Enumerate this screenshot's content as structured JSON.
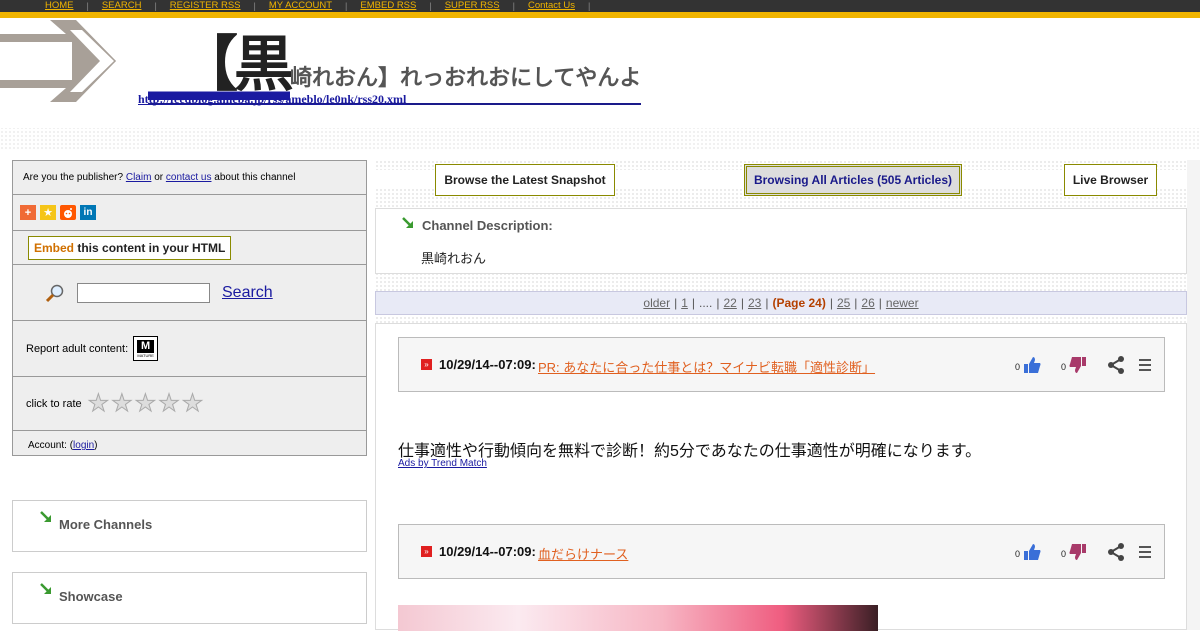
{
  "nav": {
    "items": [
      "HOME",
      "SEARCH",
      "REGISTER RSS",
      "MY ACCOUNT",
      "EMBED RSS",
      "SUPER RSS",
      "Contact Us"
    ],
    "separator": "|"
  },
  "header": {
    "title_big": "【黒",
    "title_rest": "崎れおん】れっおれおにしてやんよ",
    "feed_url": "http://feedblog.ameba.jp/rss/ameblo/le0nk/rss20.xml"
  },
  "sidebar": {
    "publisher_prefix": "Are you the publisher?",
    "claim": "Claim",
    "or": "or",
    "contact": "contact us",
    "publisher_suffix": "about this channel",
    "embed_word": "Embed",
    "embed_rest": " this content in your HTML",
    "search_label": "Search",
    "report_label": "Report adult content:",
    "mature_letter": "M",
    "mature_text": "MATURE",
    "rate_label": "click to rate",
    "account_prefix": "Account: (",
    "login": "login",
    "account_suffix": ")",
    "more_channels": "More Channels",
    "showcase": "Showcase"
  },
  "tabs": {
    "latest": "Browse the Latest Snapshot",
    "all": "Browsing All Articles (505 Articles)",
    "live": "Live Browser"
  },
  "channel": {
    "desc_label": "Channel Description:",
    "desc_text": "黒崎れおん"
  },
  "pager": {
    "older": "older",
    "p1": "1",
    "dots": "....",
    "p22": "22",
    "p23": "23",
    "current": "(Page 24)",
    "p25": "25",
    "p26": "26",
    "newer": "newer",
    "sep": "|"
  },
  "posts": [
    {
      "date": "10/29/14--07:09:",
      "title": "PR: あなたに合った仕事とは？マイナビ転職「適性診断」",
      "likes": "0",
      "dislikes": "0"
    },
    {
      "date": "10/29/14--07:09:",
      "title": "血だらけナース",
      "likes": "0",
      "dislikes": "0"
    }
  ],
  "ad": {
    "text": "仕事適性や行動傾向を無料で診断！約5分であなたの仕事適性が明確になります。",
    "link": "Ads by Trend Match"
  }
}
